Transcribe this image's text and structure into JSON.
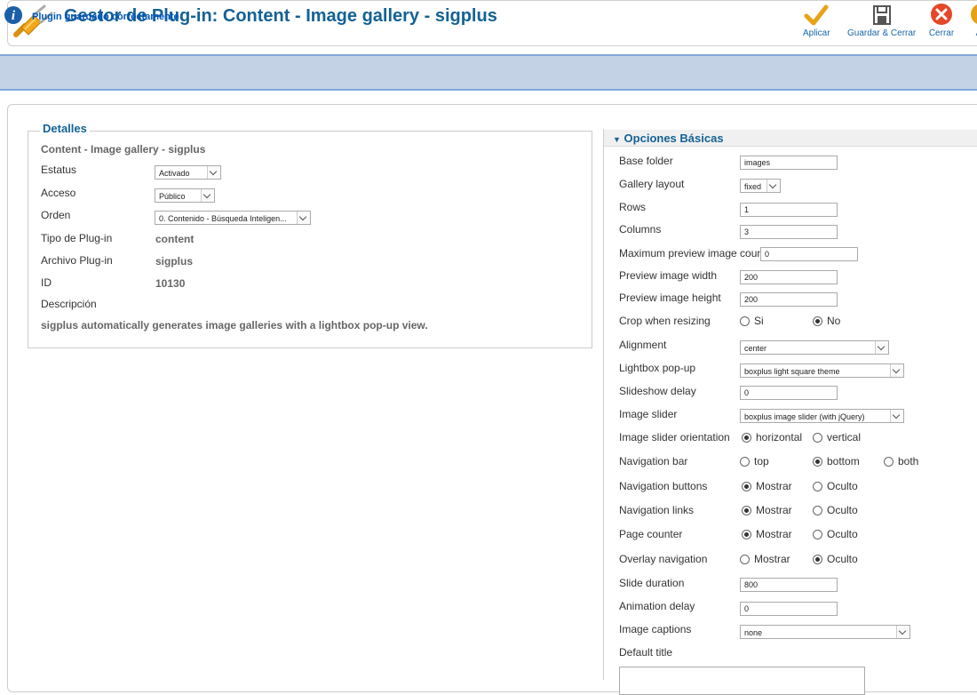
{
  "header": {
    "title": "Gestor de Plug-in: Content - Image gallery - sigplus",
    "toolbar": {
      "apply": "Aplicar",
      "save_close": "Guardar & Cerrar",
      "close": "Cerrar",
      "cut": "A"
    }
  },
  "message": "Plugin guardado correctamente",
  "details": {
    "legend": "Detalles",
    "subtitle": "Content - Image gallery - sigplus",
    "status_label": "Estatus",
    "status_value": "Activado",
    "access_label": "Acceso",
    "access_value": "Público",
    "order_label": "Orden",
    "order_value": "0. Contenido - Búsqueda Inteligen...",
    "type_label": "Tipo de Plug-in",
    "type_value": "content",
    "file_label": "Archivo Plug-in",
    "file_value": "sigplus",
    "id_label": "ID",
    "id_value": "10130",
    "desc_label": "Descripción",
    "desc_value": "sigplus automatically generates image galleries with a lightbox pop-up view."
  },
  "options": {
    "title": "Opciones Básicas",
    "base_folder": {
      "label": "Base folder",
      "value": "images"
    },
    "gallery_layout": {
      "label": "Gallery layout",
      "value": "fixed"
    },
    "rows": {
      "label": "Rows",
      "value": "1"
    },
    "columns": {
      "label": "Columns",
      "value": "3"
    },
    "max_count": {
      "label": "Maximum preview image count",
      "value": "0"
    },
    "preview_width": {
      "label": "Preview image width",
      "value": "200"
    },
    "preview_height": {
      "label": "Preview image height",
      "value": "200"
    },
    "crop": {
      "label": "Crop when resizing",
      "opt1": "Si",
      "opt2": "No"
    },
    "alignment": {
      "label": "Alignment",
      "value": "center"
    },
    "lightbox": {
      "label": "Lightbox pop-up",
      "value": "boxplus light square theme"
    },
    "slideshow_delay": {
      "label": "Slideshow delay",
      "value": "0"
    },
    "image_slider": {
      "label": "Image slider",
      "value": "boxplus image slider (with jQuery)"
    },
    "slider_orientation": {
      "label": "Image slider orientation",
      "opt1": "horizontal",
      "opt2": "vertical"
    },
    "nav_bar": {
      "label": "Navigation bar",
      "opt1": "top",
      "opt2": "bottom",
      "opt3": "both"
    },
    "nav_buttons": {
      "label": "Navigation buttons",
      "opt1": "Mostrar",
      "opt2": "Oculto"
    },
    "nav_links": {
      "label": "Navigation links",
      "opt1": "Mostrar",
      "opt2": "Oculto"
    },
    "page_counter": {
      "label": "Page counter",
      "opt1": "Mostrar",
      "opt2": "Oculto"
    },
    "overlay_nav": {
      "label": "Overlay navigation",
      "opt1": "Mostrar",
      "opt2": "Oculto"
    },
    "slide_duration": {
      "label": "Slide duration",
      "value": "800"
    },
    "animation_delay": {
      "label": "Animation delay",
      "value": "0"
    },
    "captions": {
      "label": "Image captions",
      "value": "none"
    },
    "default_title": {
      "label": "Default title"
    }
  }
}
